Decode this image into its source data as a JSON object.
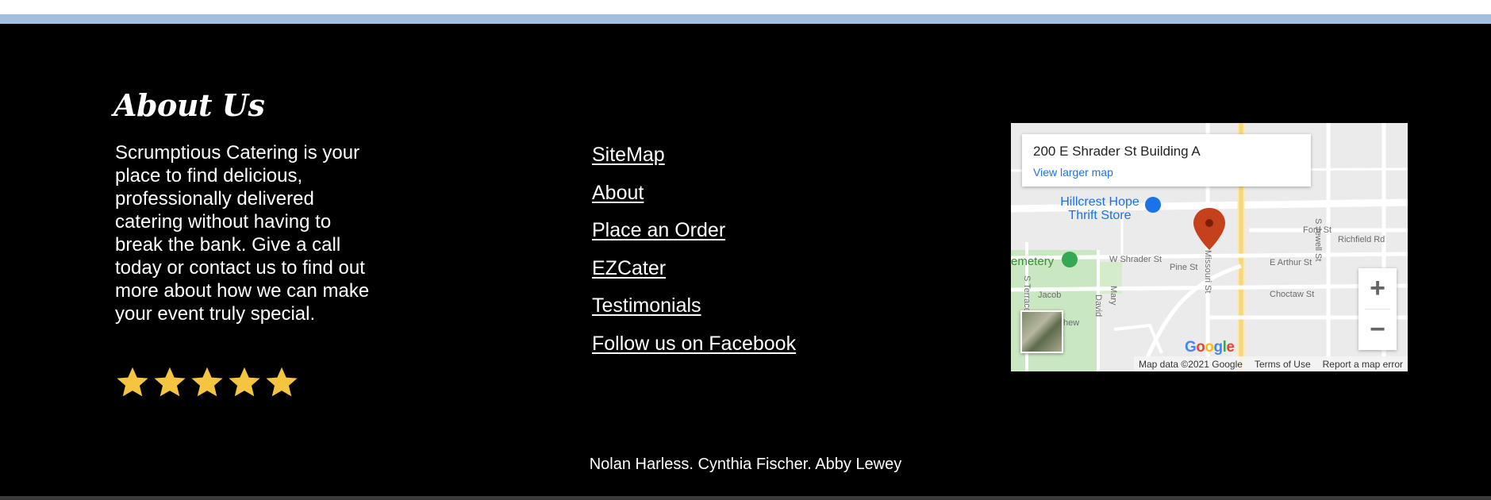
{
  "about": {
    "title": "About Us",
    "text": "Scrumptious Catering is your place to find delicious, professionally delivered catering without having to break the bank. Give a call today or contact us to find out more about how we can make your event truly special.",
    "rating": 5,
    "star_color": "#f5c542"
  },
  "links": [
    {
      "label": "SiteMap"
    },
    {
      "label": "About"
    },
    {
      "label": "Place an Order"
    },
    {
      "label": "EZCater"
    },
    {
      "label": "Testimonials"
    },
    {
      "label": "Follow us on Facebook"
    }
  ],
  "map": {
    "address": "200 E Shrader St Building A",
    "view_larger": "View larger map",
    "poi": "Hillcrest Hope Thrift Store",
    "streets": [
      "Ford St",
      "Richfield Rd",
      "W Shrader St",
      "Pine St",
      "E Arthur St",
      "Choctaw St",
      "Missouri St",
      "S Jewell St",
      "S Terrace",
      "Jacob",
      "David",
      "Mary",
      "hew",
      "emetery"
    ],
    "zoom_in": "+",
    "zoom_out": "−",
    "google": "Google",
    "attribution": {
      "data": "Map data ©2021 Google",
      "terms": "Terms of Use",
      "report": "Report a map error"
    }
  },
  "footer": {
    "credits": "Nolan Harless. Cynthia Fischer. Abby Lewey"
  }
}
